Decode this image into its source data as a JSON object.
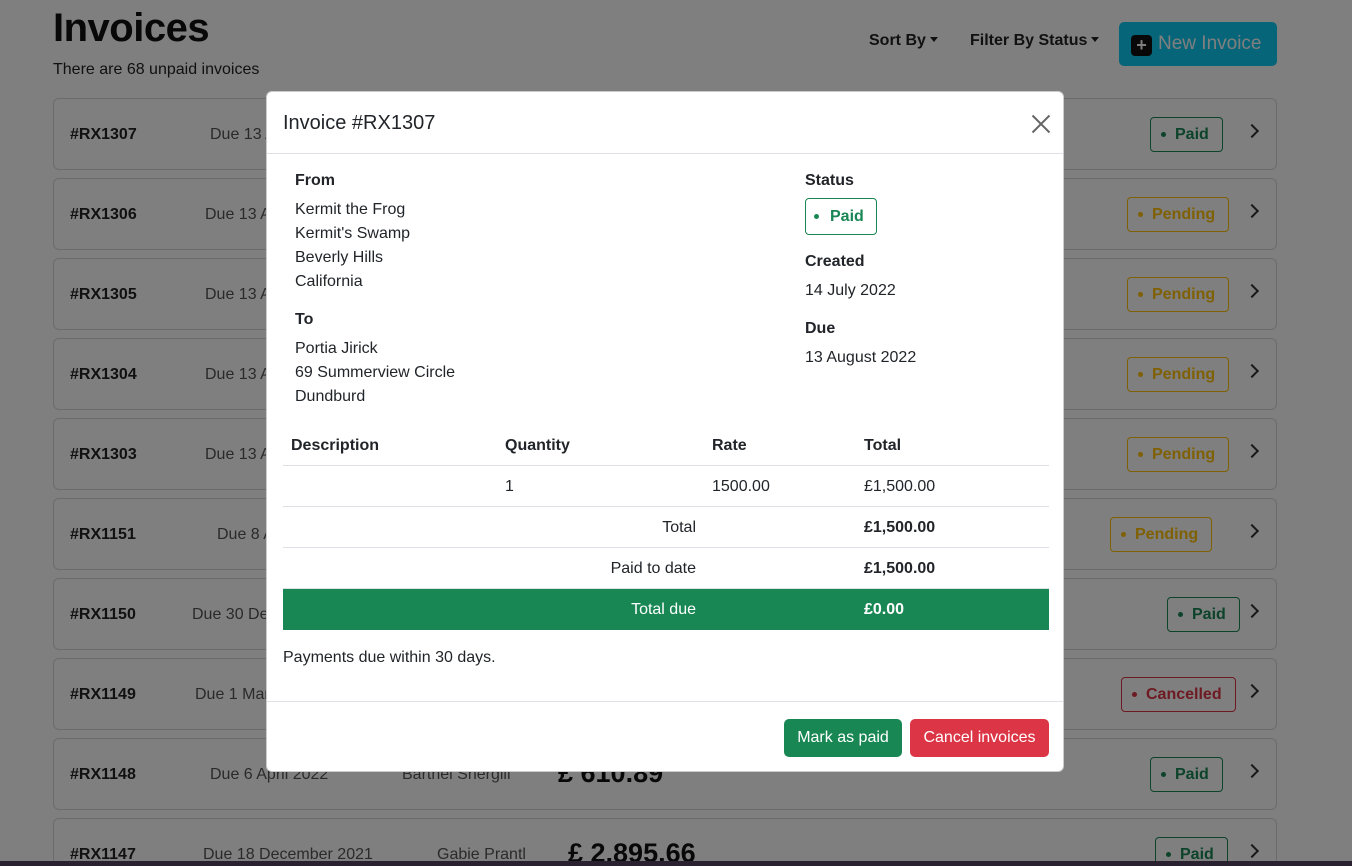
{
  "page": {
    "title": "Invoices",
    "subtitle": "There are 68 unpaid invoices",
    "sort_label": "Sort By",
    "filter_label": "Filter By Status",
    "new_invoice_label": "New Invoice"
  },
  "invoices": [
    {
      "id": "#RX1307",
      "due": "Due 13 A",
      "name": "",
      "amount": "",
      "status": "Paid"
    },
    {
      "id": "#RX1306",
      "due": "Due 13 A",
      "name": "",
      "amount": "",
      "status": "Pending"
    },
    {
      "id": "#RX1305",
      "due": "Due 13 A",
      "name": "",
      "amount": "",
      "status": "Pending"
    },
    {
      "id": "#RX1304",
      "due": "Due 13 A",
      "name": "",
      "amount": "",
      "status": "Pending"
    },
    {
      "id": "#RX1303",
      "due": "Due 13 A",
      "name": "",
      "amount": "",
      "status": "Pending"
    },
    {
      "id": "#RX1151",
      "due": "Due 8 A",
      "name": "",
      "amount": "",
      "status": "Pending"
    },
    {
      "id": "#RX1150",
      "due": "Due 30 De",
      "name": "",
      "amount": "",
      "status": "Paid"
    },
    {
      "id": "#RX1149",
      "due": "Due 1 Mar",
      "name": "",
      "amount": "",
      "status": "Cancelled"
    },
    {
      "id": "#RX1148",
      "due": "Due 6 April 2022",
      "name": "Barthel Shergill",
      "amount": "£ 610.89",
      "status": "Paid"
    },
    {
      "id": "#RX1147",
      "due": "Due 18 December 2021",
      "name": "Gabie Prantl",
      "amount": "£ 2,895.66",
      "status": "Paid"
    }
  ],
  "modal": {
    "title": "Invoice #RX1307",
    "from_label": "From",
    "from_lines": [
      "Kermit the Frog",
      "Kermit's Swamp",
      "Beverly Hills",
      "California"
    ],
    "to_label": "To",
    "to_lines": [
      "Portia Jirick",
      "69 Summerview Circle",
      "Dundburd"
    ],
    "status_label": "Status",
    "status_value": "Paid",
    "created_label": "Created",
    "created_value": "14 July 2022",
    "due_label": "Due",
    "due_value": "13 August 2022",
    "table": {
      "headers": [
        "Description",
        "Quantity",
        "Rate",
        "Total"
      ],
      "rows": [
        {
          "description": "",
          "quantity": "1",
          "rate": "1500.00",
          "total": "£1,500.00"
        }
      ],
      "summary": [
        {
          "label": "Total",
          "value": "£1,500.00"
        },
        {
          "label": "Paid to date",
          "value": "£1,500.00"
        }
      ],
      "total_due_label": "Total due",
      "total_due_value": "£0.00"
    },
    "note": "Payments due within 30 days.",
    "mark_paid_label": "Mark as paid",
    "cancel_label": "Cancel invoices"
  },
  "colors": {
    "paid": "#198754",
    "pending": "#ffc107",
    "cancelled": "#dc3545",
    "accent": "#0dcaf0"
  }
}
